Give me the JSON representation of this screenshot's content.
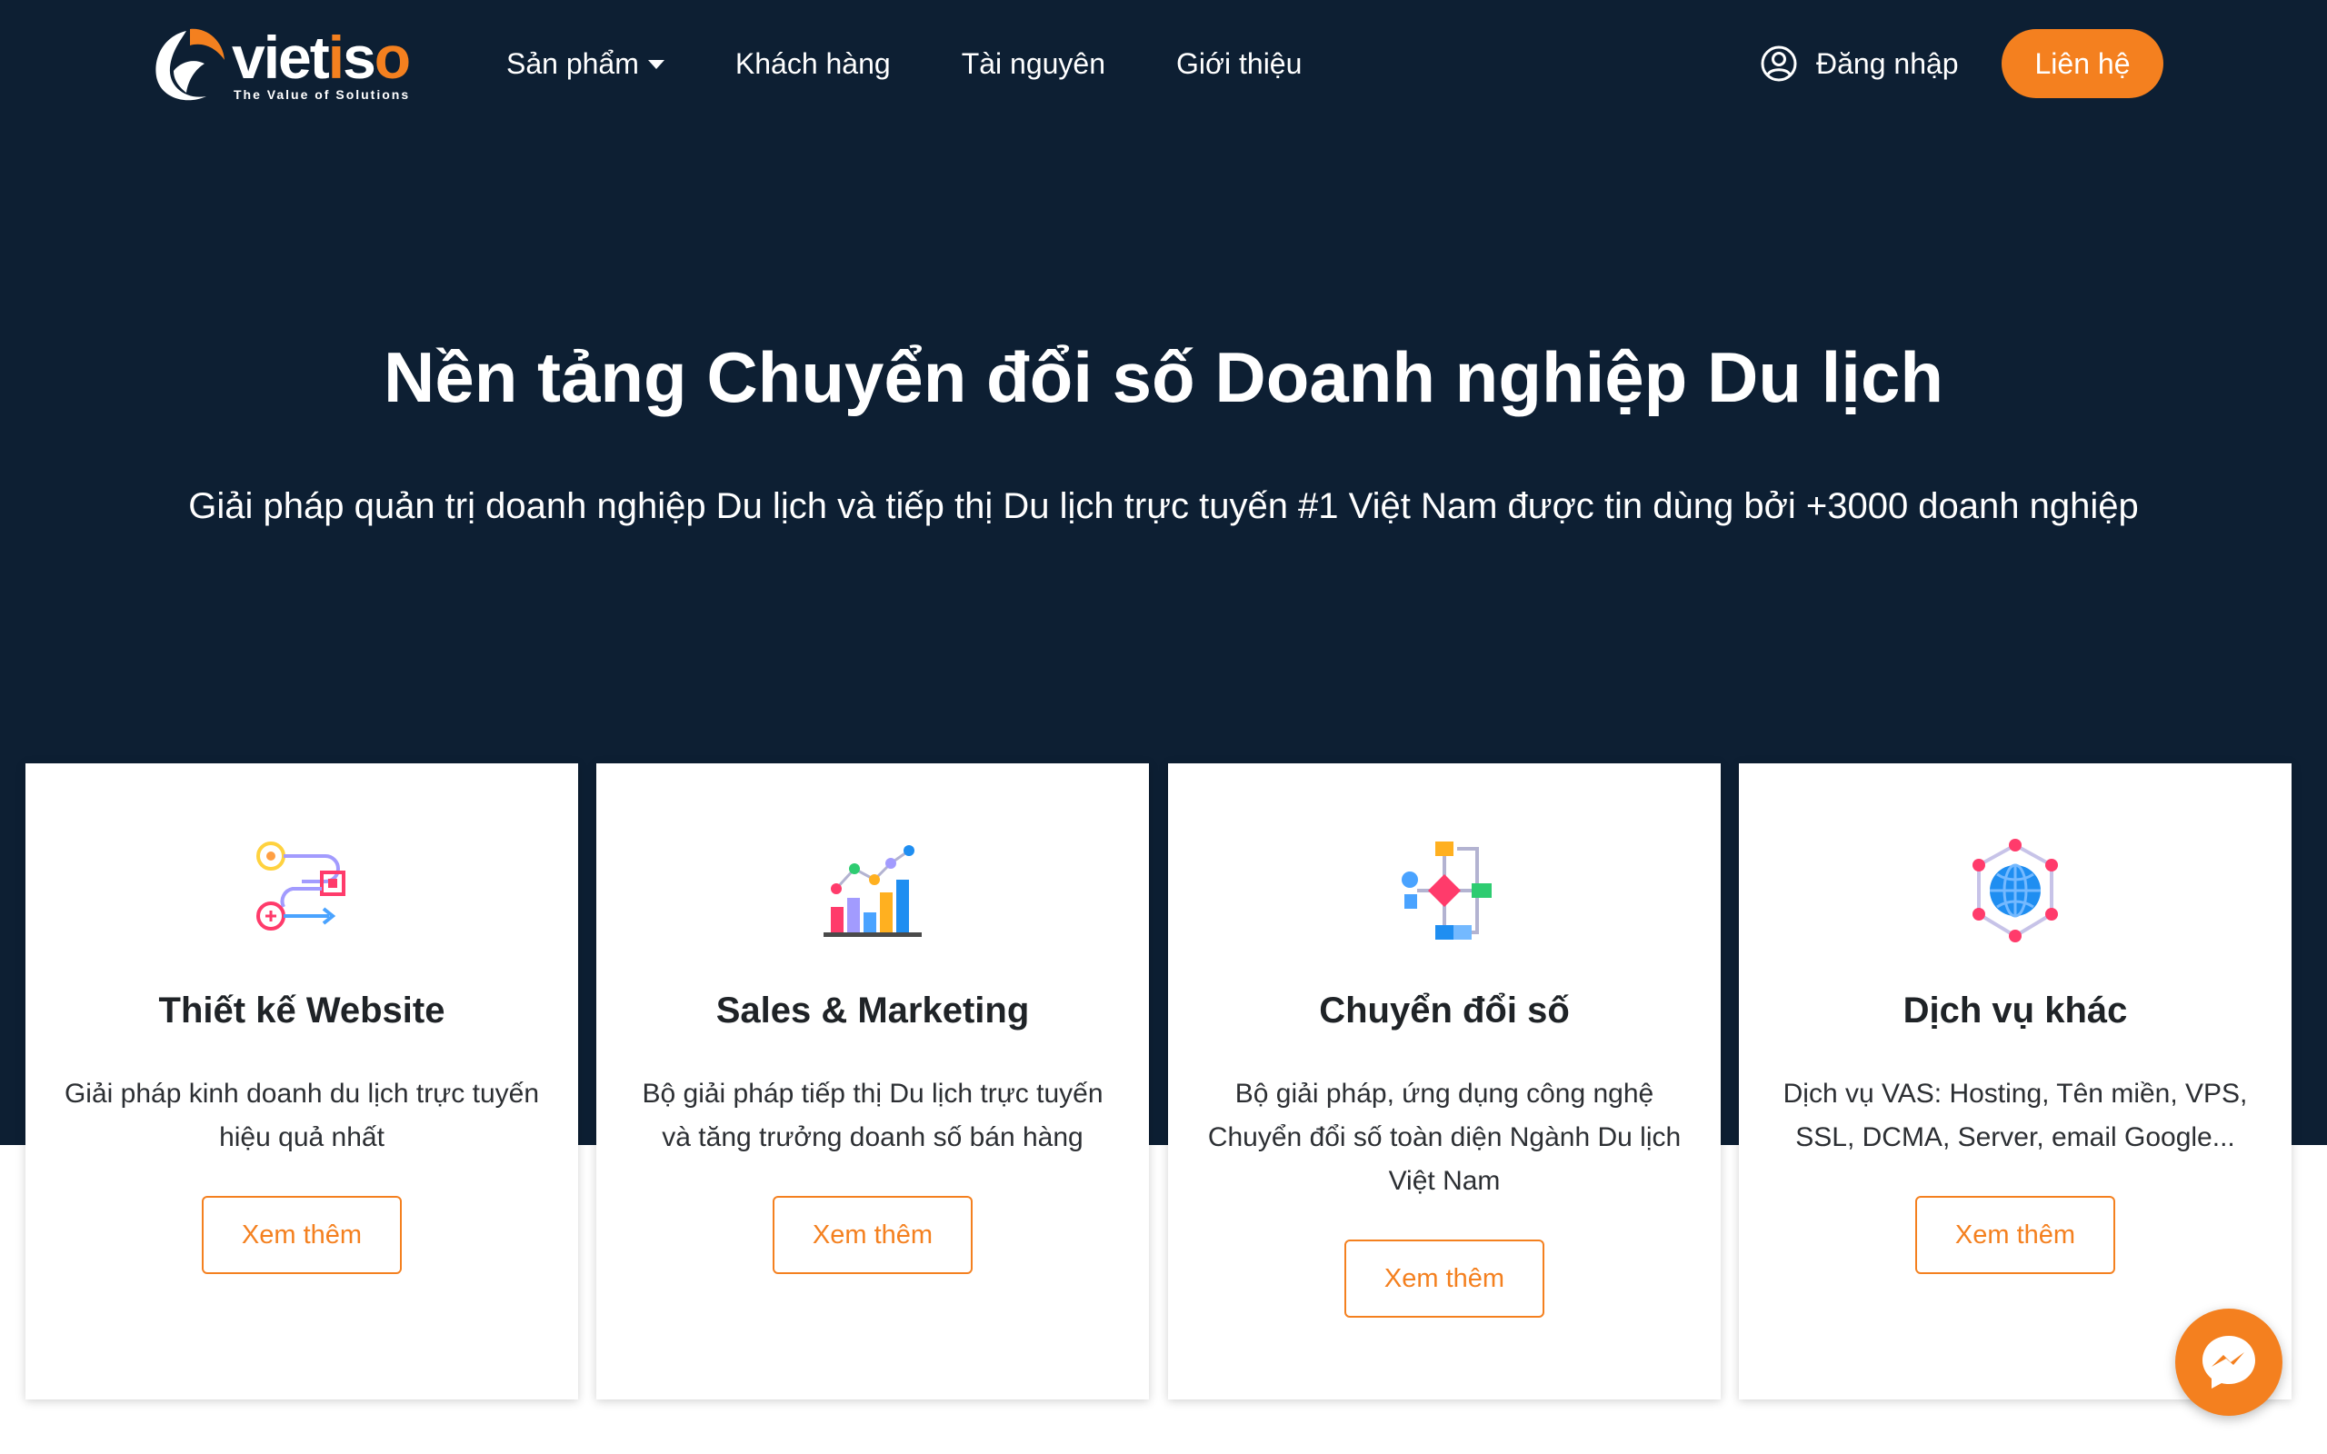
{
  "brand": {
    "name_prefix": "viet",
    "name_accent_i": "i",
    "name_suffix_s": "s",
    "name_accent_o": "o",
    "tagline": "The Value of Solutions",
    "accent_color": "#f4801f",
    "hero_bg": "#0d1f33"
  },
  "nav": {
    "items": [
      {
        "label": "Sản phẩm",
        "has_dropdown": true
      },
      {
        "label": "Khách hàng"
      },
      {
        "label": "Tài nguyên"
      },
      {
        "label": "Giới thiệu"
      }
    ],
    "login_label": "Đăng nhập",
    "login_icon": "user-circle-icon",
    "contact_label": "Liên hệ"
  },
  "hero": {
    "title": "Nền tảng Chuyển đổi số Doanh nghiệp Du lịch",
    "subtitle": "Giải pháp quản trị doanh nghiệp Du lịch và tiếp thị Du lịch trực tuyến #1 Việt Nam được tin dùng bởi +3000 doanh nghiệp"
  },
  "cards": [
    {
      "icon": "workflow-icon",
      "title": "Thiết kế Website",
      "description": "Giải pháp kinh doanh du lịch trực tuyến hiệu quả nhất",
      "button": "Xem thêm"
    },
    {
      "icon": "growth-chart-icon",
      "title": "Sales & Marketing",
      "description": "Bộ giải pháp tiếp thị Du lịch trực tuyến và tăng trưởng doanh số bán hàng",
      "button": "Xem thêm"
    },
    {
      "icon": "flowchart-icon",
      "title": "Chuyển đổi số",
      "description": "Bộ giải pháp, ứng dụng công nghệ Chuyển đổi số toàn diện Ngành Du lịch Việt Nam",
      "button": "Xem thêm"
    },
    {
      "icon": "globe-network-icon",
      "title": "Dịch vụ khác",
      "description": "Dịch vụ VAS: Hosting, Tên miền, VPS, SSL, DCMA, Server, email Google...",
      "button": "Xem thêm"
    }
  ],
  "chat": {
    "icon": "messenger-icon"
  }
}
